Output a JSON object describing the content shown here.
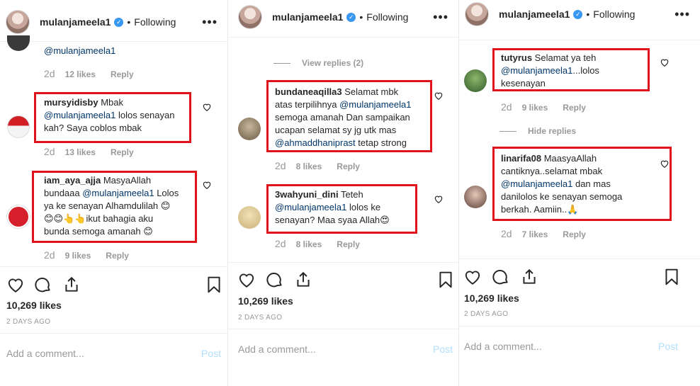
{
  "header": {
    "username": "mulanjameela1",
    "following": "Following",
    "more": "•••",
    "dot": "•",
    "verified": "✓"
  },
  "actions": {
    "likes": "10,269 likes",
    "ago": "2 DAYS AGO",
    "add_comment": "Add a comment...",
    "post": "Post"
  },
  "panel1": {
    "c0": {
      "mention": "@mulanjameela1",
      "date": "2d",
      "likes": "12 likes",
      "reply": "Reply"
    },
    "c1": {
      "user": "mursyidisby",
      "t1": " Mbak",
      "mention": "@mulanjameela1",
      "t2": " lolos senayan",
      "t3": "kah? Saya coblos mbak",
      "date": "2d",
      "likes": "13 likes",
      "reply": "Reply"
    },
    "c2": {
      "user": "iam_aya_ajja",
      "t1": " MasyaAllah",
      "t2": "bundaaa ",
      "mention": "@mulanjameela1",
      "t3": " Lolos",
      "t4": "ya ke senayan Alhamdulilah 😊",
      "t5": "😊😊👆👆ikut bahagia aku",
      "t6": "bunda semoga amanah 😊",
      "date": "2d",
      "likes": "9 likes",
      "reply": "Reply"
    }
  },
  "panel2": {
    "view_replies": "View replies (2)",
    "c1": {
      "user": "bundaneaqilla3",
      "t1": " Selamat mbk",
      "t2": "atas terpilihnya ",
      "mention1": "@mulanjameela1",
      "t3": "semoga amanah Dan sampaikan",
      "t4": "ucapan selamat sy jg utk mas",
      "mention2": "@ahmaddhaniprast",
      "t5": " tetap strong",
      "date": "2d",
      "likes": "8 likes",
      "reply": "Reply"
    },
    "c2": {
      "user": "3wahyuni_dini",
      "t1": " Teteh",
      "mention": "@mulanjameela1",
      "t2": " lolos ke",
      "t3": "senayan? Maa syaa Allah😍",
      "date": "2d",
      "likes": "8 likes",
      "reply": "Reply"
    }
  },
  "panel3": {
    "hide_replies": "Hide replies",
    "c1": {
      "user": "tutyrus",
      "t1": " Selamat ya teh",
      "mention": "@mulanjameela1",
      "t2": "...lolos",
      "t3": "kesenayan",
      "date": "2d",
      "likes": "9 likes",
      "reply": "Reply"
    },
    "c2": {
      "user": "linarifa08",
      "t1": " MaasyaAllah",
      "t2": "cantiknya..selamat mbak",
      "mention": "@mulanjameela1",
      "t3": " dan mas",
      "t4": "danilolos ke senayan semoga",
      "t5": "berkah. Aamiin..🙏",
      "date": "2d",
      "likes": "7 likes",
      "reply": "Reply"
    }
  },
  "icons": [
    "heart-icon",
    "comment-icon",
    "share-icon",
    "bookmark-icon"
  ],
  "colors": {
    "highlight_box": "#e0121b",
    "mention": "#003569",
    "muted": "#999999",
    "post_disabled": "#b2dffc",
    "verified": "#3897f0"
  }
}
